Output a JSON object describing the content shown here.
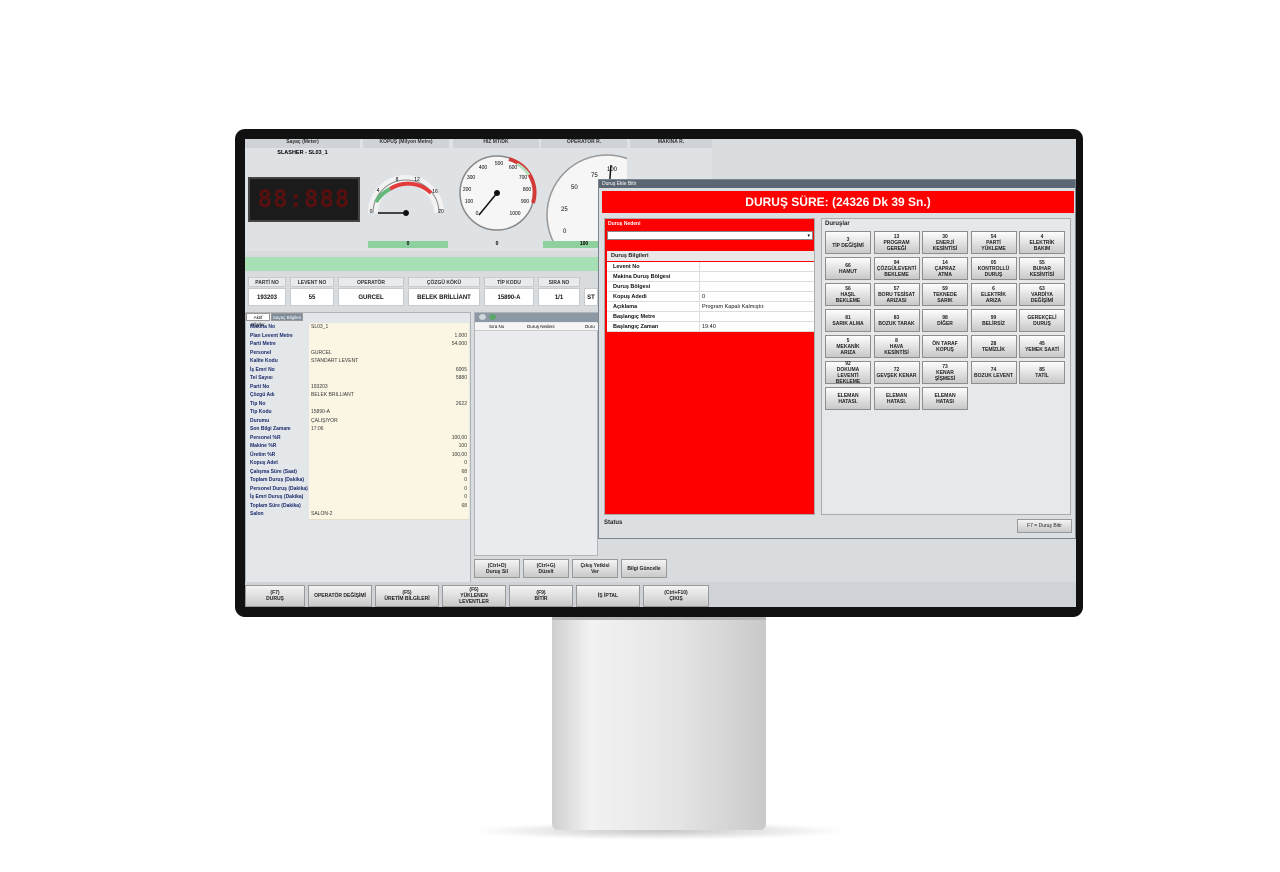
{
  "gauges": {
    "counter_title": "Sayaç (Meter)",
    "counter_subtitle": "SLASHER - SL03_1",
    "counter_display": "88:888",
    "kopus_title": "KOPUŞ (Milyon Metre)",
    "kopus_ticks": [
      "0",
      "4",
      "8",
      "12",
      "16",
      "20"
    ],
    "kopus_value": "0",
    "hiz_title": "HIZ MT/DK",
    "hiz_ticks": [
      "0",
      "100",
      "200",
      "300",
      "400",
      "500",
      "600",
      "700",
      "800",
      "900",
      "1000"
    ],
    "hiz_value": "0",
    "operator_title": "OPERATÖR R.",
    "operator_ticks": [
      "0",
      "25",
      "50",
      "75",
      "100"
    ],
    "operator_value": "100",
    "makina_title": "MAKİNA R."
  },
  "info": {
    "headers": [
      "PARTİ NO",
      "LEVENT NO",
      "OPERATÖR",
      "ÇÖZGÜ KÖKÜ",
      "TİP KODU",
      "SIRA NO"
    ],
    "values": [
      "193203",
      "55",
      "GURCEL",
      "BELEK BRİLLİANT",
      "15890-A",
      "1/1",
      "ST"
    ]
  },
  "tabs": [
    "Aktif Bilgiler",
    "Sayaç Bilgileri"
  ],
  "details": [
    {
      "label": "Makina No",
      "value": "SL03_1",
      "num": false
    },
    {
      "label": "Plan Levent Metre",
      "value": "1.000",
      "num": true
    },
    {
      "label": "Parti Metre",
      "value": "54.000",
      "num": true
    },
    {
      "label": "Personel",
      "value": "GURCEL",
      "num": false
    },
    {
      "label": "Kalite Kodu",
      "value": "STANDART LEVENT",
      "num": false
    },
    {
      "label": "İş Emri No",
      "value": "6005",
      "num": true
    },
    {
      "label": "Tel Sayısı",
      "value": "5880",
      "num": true
    },
    {
      "label": "Parti No",
      "value": "193203",
      "num": false
    },
    {
      "label": "Çözgü Adı",
      "value": "BELEK BRILLIANT",
      "num": false
    },
    {
      "label": "Tip No",
      "value": "2622",
      "num": true
    },
    {
      "label": "Tip Kodu",
      "value": "15890-A",
      "num": false
    },
    {
      "label": "Durumu",
      "value": "ÇALIŞIYOR",
      "num": false
    },
    {
      "label": "Son Bilgi Zamanı",
      "value": "17:06",
      "num": false
    },
    {
      "label": "Personel %R",
      "value": "100,00",
      "num": true
    },
    {
      "label": "Makine %R",
      "value": "100",
      "num": true
    },
    {
      "label": "Üretim %R",
      "value": "100,00",
      "num": true
    },
    {
      "label": "Kopuş Adet",
      "value": "0",
      "num": true
    },
    {
      "label": "Çalışma Süre (Saat)",
      "value": "68",
      "num": true
    },
    {
      "label": "Toplam Duruş (Dakika)",
      "value": "0",
      "num": true
    },
    {
      "label": "Personel Duruş (Dakika)",
      "value": "0",
      "num": true
    },
    {
      "label": "İş Emri Duruş (Dakika)",
      "value": "0",
      "num": true
    },
    {
      "label": "Toplam Süre (Dakika)",
      "value": "68",
      "num": true
    },
    {
      "label": "Salon",
      "value": "SALON-2",
      "num": false
    }
  ],
  "middle_grid": {
    "headers": [
      "Sıra No",
      "Duruş Nedeni",
      "Duru"
    ]
  },
  "middle_buttons": [
    "(Ctrl+D)\nDuruş Sil",
    "(Ctrl+G)\nDüzelt",
    "Çıkış Yetkisi\nVer",
    "Bilgi Güncelle"
  ],
  "bottom_buttons": [
    "(F7)\nDURUŞ",
    "OPERATÖR DEĞİŞİMİ",
    "(F5)\nÜRETİM BİLGİLERİ",
    "(F6)\nYÜKLENEN\nLEVENTLER",
    "(F9)\nBİTİR",
    "İŞ İPTAL",
    "(Ctrl+F10)\nÇIKIŞ"
  ],
  "dialog": {
    "window_title": "Duruş Ekle Bitir",
    "banner": "DURUŞ SÜRE:    (24326 Dk 39 Sn.)",
    "reason_label": "Duruş Nedeni",
    "info_label": "Duruş Bilgileri",
    "rows": [
      {
        "label": "Levent No",
        "value": ""
      },
      {
        "label": "Makina Duruş Bölgesi",
        "value": ""
      },
      {
        "label": "Duruş Bölgesi",
        "value": ""
      },
      {
        "label": "Kopuş Adedi",
        "value": "0"
      },
      {
        "label": "Açıklama",
        "value": "Program Kapalı Kalmıştır."
      },
      {
        "label": "Başlangıç Metre",
        "value": ""
      },
      {
        "label": "Başlangıç Zaman",
        "value": "19:40"
      }
    ],
    "stops_label": "Duruşlar",
    "stops": [
      [
        "3",
        "TİP DEĞİŞİMİ"
      ],
      [
        "13",
        "PROGRAM\nGEREĞİ"
      ],
      [
        "30",
        "ENERJİ\nKESİNTİSİ"
      ],
      [
        "54",
        "PARTİ\nYÜKLEME"
      ],
      [
        "4",
        "ELEKTRİK\nBAKIM"
      ],
      [
        "66",
        "HAMUT"
      ],
      [
        "94",
        "ÇÖZGÜLEVENTİ\nBEKLEME"
      ],
      [
        "14",
        "ÇAPRAZ\nATMA"
      ],
      [
        "05",
        "KONTROLLÜ\nDURUŞ"
      ],
      [
        "55",
        "BUHAR\nKESİNTİSİ"
      ],
      [
        "56",
        "HAŞIL\nBEKLEME"
      ],
      [
        "57",
        "BORU TESİSAT\nARIZASI"
      ],
      [
        "59",
        "TEKNEDE\nSARIK"
      ],
      [
        "6",
        "ELEKTRİK\nARIZA"
      ],
      [
        "63",
        "VARDİYA\nDEĞİŞİMİ"
      ],
      [
        "81",
        "SARIK ALMA"
      ],
      [
        "83",
        "BOZUK TARAK"
      ],
      [
        "98",
        "DİĞER"
      ],
      [
        "99",
        "BELİRSİZ"
      ],
      [
        "",
        "GEREKÇELİ\nDURUŞ"
      ],
      [
        "5",
        "MEKANİK\nARIZA"
      ],
      [
        "8",
        "HAVA\nKESİNTİSİ"
      ],
      [
        "",
        "ÖN TARAF\nKOPUŞ"
      ],
      [
        "28",
        "TEMİZLİK"
      ],
      [
        "45",
        "YEMEK SAATİ"
      ],
      [
        "92",
        "DOKUMA\nLEVENTİ\nBEKLEME"
      ],
      [
        "72",
        "GEVŞEK KENAR"
      ],
      [
        "73",
        "KENAR\nŞİŞMESİ"
      ],
      [
        "74",
        "BOZUK LEVENT"
      ],
      [
        "85",
        "TATİL"
      ],
      [
        "",
        "ELEMAN\nHATASI."
      ],
      [
        "",
        "ELEMAN\nHATASI."
      ],
      [
        "",
        "ELEMAN\nHATASI"
      ]
    ],
    "status_label": "Status",
    "finish_button": "F7 = Duruş Bitir"
  },
  "colors": {
    "alarm_red": "#ff0000",
    "gauge_green": "#8fd19e"
  }
}
